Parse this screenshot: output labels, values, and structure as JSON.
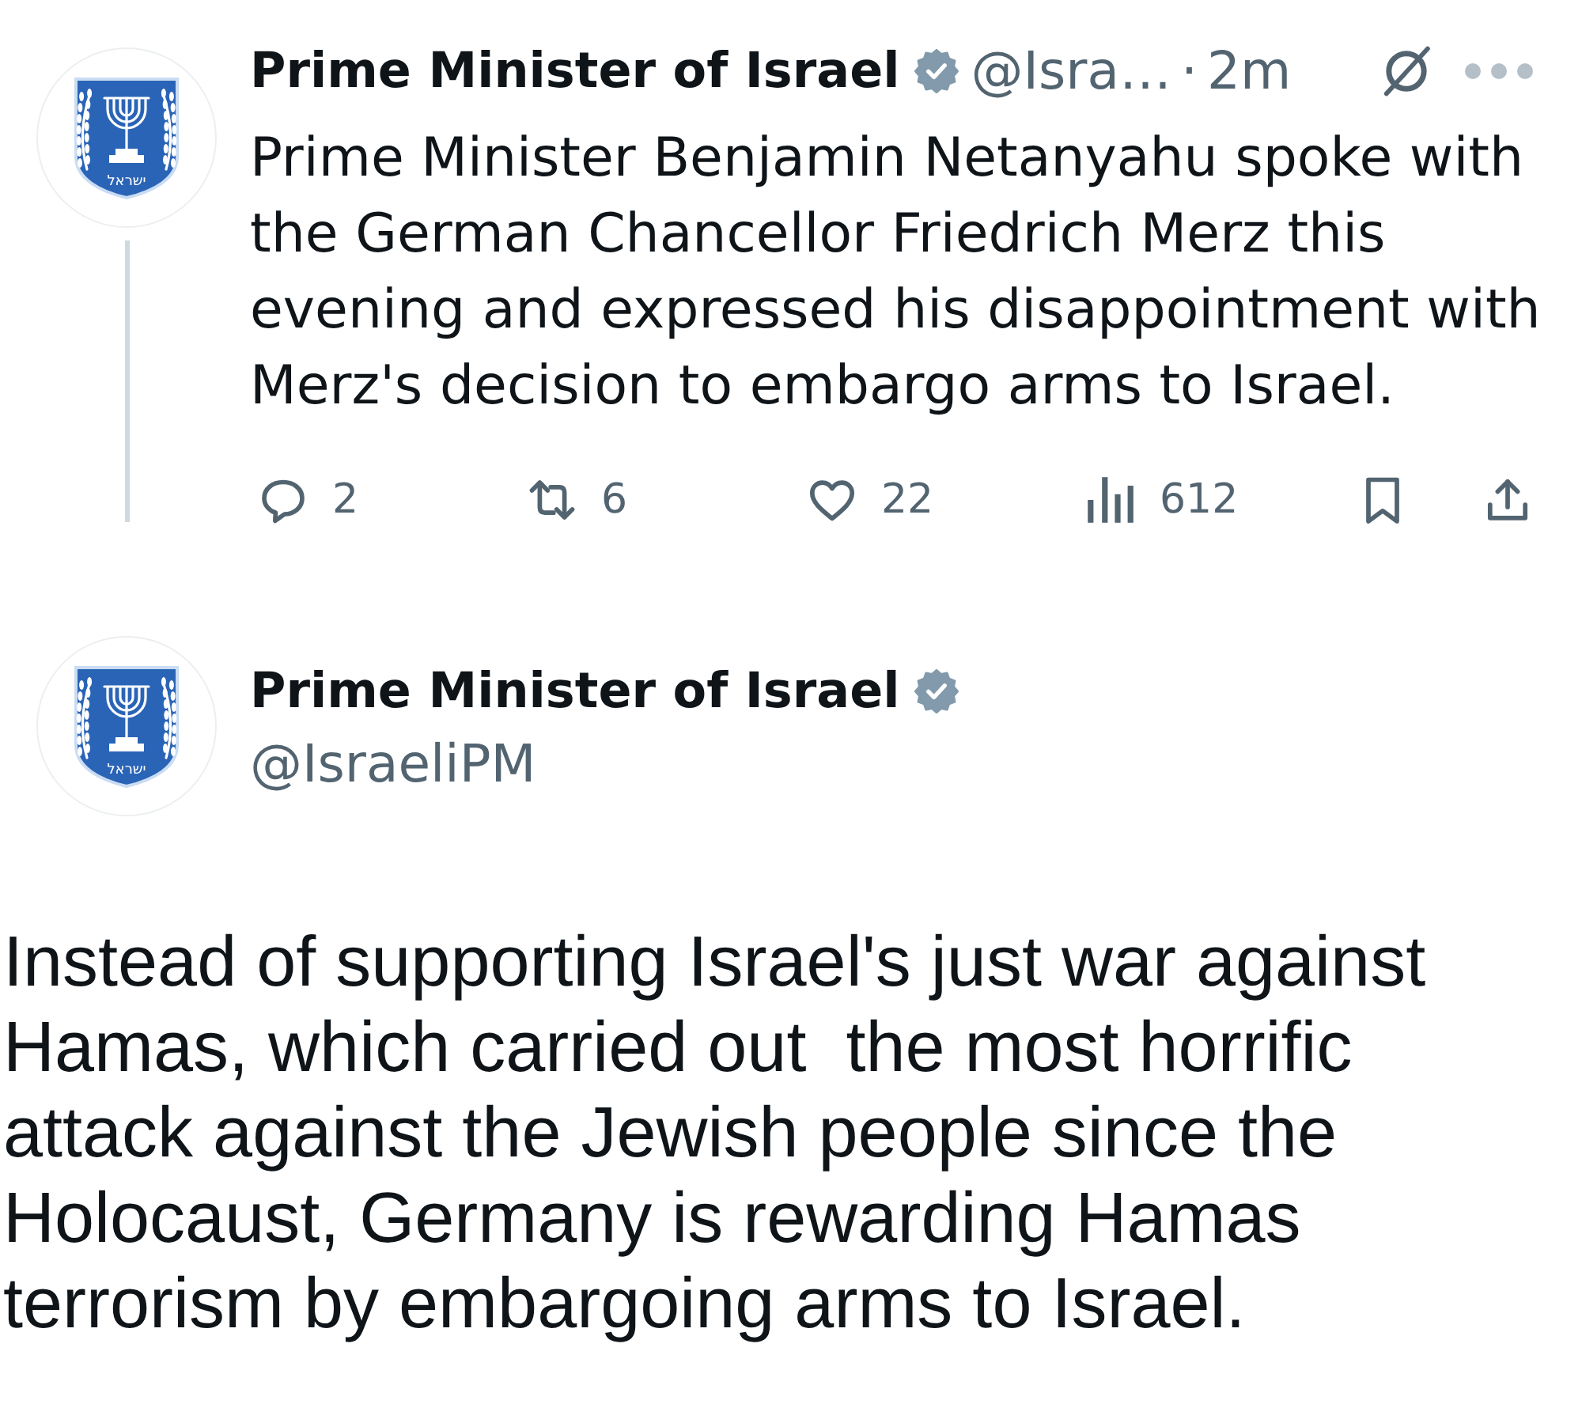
{
  "parent_post": {
    "author": {
      "name": "Prime Minister of Israel",
      "verified": true,
      "handle": "@Isra…",
      "separator": "·",
      "time": "2m",
      "emblem_text": "ישראל"
    },
    "text": "Prime Minister Benjamin Netanyahu spoke with the German Chancellor Friedrich Merz this evening and expressed his disappointment with Merz's decision to embargo arms to Israel.",
    "actions": [
      {
        "kind": "reply",
        "count": "2"
      },
      {
        "kind": "repost",
        "count": "6"
      },
      {
        "kind": "like",
        "count": "22"
      },
      {
        "kind": "views",
        "count": "612"
      },
      {
        "kind": "bookmark"
      },
      {
        "kind": "share"
      }
    ]
  },
  "main_post": {
    "author": {
      "name": "Prime Minister of Israel",
      "verified": true,
      "handle": "@IsraeliPM",
      "emblem_text": "ישראל"
    },
    "text": "Instead of supporting Israel's just war against Hamas, which carried out  the most horrific attack against the Jewish people since the Holocaust, Germany is rewarding Hamas terrorism by embargoing arms to Israel."
  }
}
